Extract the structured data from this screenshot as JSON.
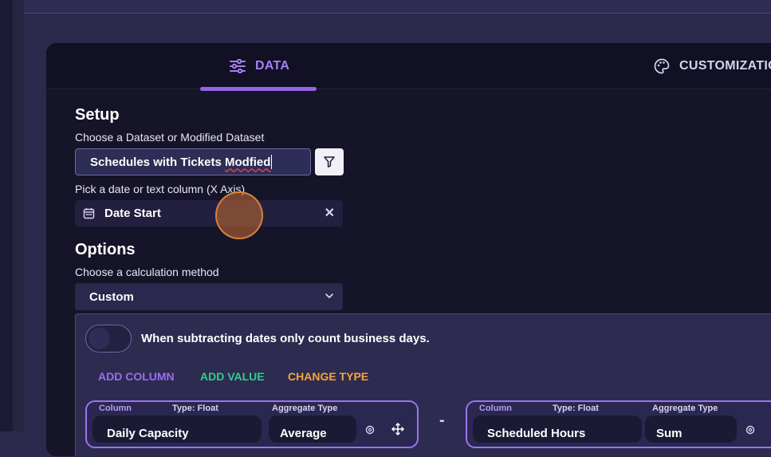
{
  "tabs": {
    "data_label": "DATA",
    "customization_label": "CUSTOMIZATION"
  },
  "setup": {
    "heading": "Setup",
    "dataset_label": "Choose a Dataset or Modified Dataset",
    "dataset_value_prefix": "Schedules with Tickets ",
    "dataset_value_typo": "Modfied",
    "xaxis_label": "Pick a date or text column (X Axis)",
    "xaxis_value": "Date Start",
    "xaxis_clear": "✕"
  },
  "options": {
    "heading": "Options",
    "calc_label": "Choose a calculation method",
    "calc_value": "Custom"
  },
  "custom": {
    "business_days_text": "When subtracting dates only count business days.",
    "business_days_enabled": false,
    "actions": {
      "add_column": "ADD COLUMN",
      "add_value": "ADD VALUE",
      "change_type": "CHANGE TYPE"
    },
    "operator": "-",
    "cards": [
      {
        "column_label": "Column",
        "type_label": "Type: Float",
        "agg_label": "Aggregate Type",
        "column_value": "Daily Capacity",
        "agg_value": "Average"
      },
      {
        "column_label": "Column",
        "type_label": "Type: Float",
        "agg_label": "Aggregate Type",
        "column_value": "Scheduled Hours",
        "agg_value": "Sum"
      }
    ]
  },
  "colors": {
    "accent": "#9463e8",
    "add_value": "#2ecf8a",
    "change_type": "#f5a43c",
    "panel_bg": "#151428"
  }
}
